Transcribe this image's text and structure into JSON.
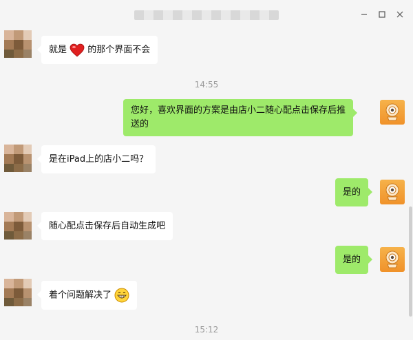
{
  "window": {
    "minimize_label": "−",
    "maximize_label": "□",
    "close_label": "×"
  },
  "messages": [
    {
      "from": "other",
      "text_before": "就是",
      "emoji": "heart",
      "text_after": "的那个界面不会"
    },
    {
      "type": "timestamp",
      "text": "14:55"
    },
    {
      "from": "self",
      "line1": "您好，喜欢界面的方案是由店小二随心配点击保存后推",
      "line2": "送的"
    },
    {
      "from": "other",
      "text": "是在iPad上的店小二吗？"
    },
    {
      "from": "self",
      "text": "是的"
    },
    {
      "from": "other",
      "text": "随心配点击保存后自动生成吧"
    },
    {
      "from": "self",
      "text": "是的"
    },
    {
      "from": "other",
      "text": "着个问题解决了",
      "emoji": "grin"
    },
    {
      "type": "timestamp",
      "text": "15:12"
    }
  ],
  "colors": {
    "background": "#f5f5f5",
    "incoming_bubble": "#ffffff",
    "outgoing_bubble": "#9eea6a",
    "timestamp": "#9a9a9a"
  }
}
